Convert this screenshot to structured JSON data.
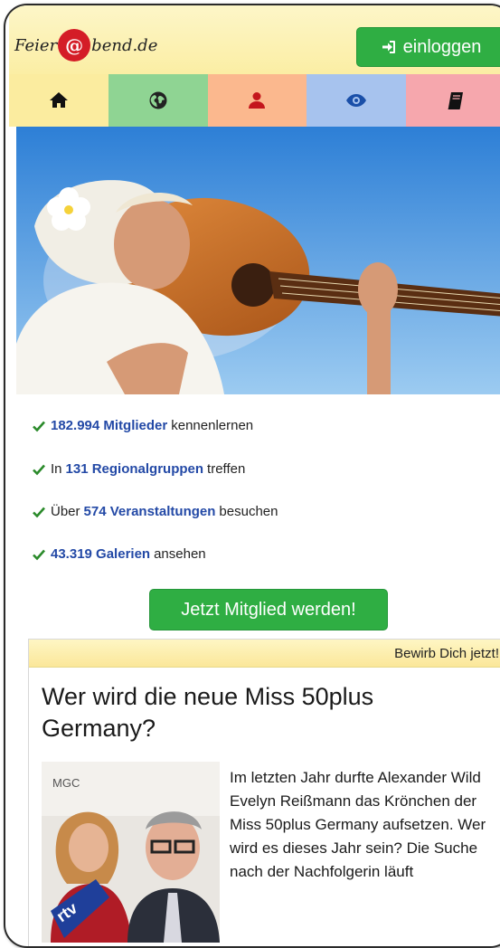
{
  "header": {
    "logo_pre": "Feier",
    "logo_at": "@",
    "logo_post": "bend.de",
    "login_label": "einloggen",
    "login_icon": "sign-in-icon"
  },
  "nav": {
    "items": [
      {
        "icon": "home-icon",
        "color": "#fbec9f"
      },
      {
        "icon": "globe-icon",
        "color": "#8fd493"
      },
      {
        "icon": "user-icon",
        "color": "#fbb88e"
      },
      {
        "icon": "eye-icon",
        "color": "#a7c3ee"
      },
      {
        "icon": "book-icon",
        "color": "#f6a7ad"
      }
    ]
  },
  "stats": [
    {
      "pre": "",
      "value": "182.994 Mitglieder",
      "post": "kennenlernen"
    },
    {
      "pre": "In",
      "value": "131 Regionalgruppen",
      "post": "treffen"
    },
    {
      "pre": "Über",
      "value": "574 Veranstaltungen",
      "post": "besuchen"
    },
    {
      "pre": "",
      "value": "43.319 Galerien",
      "post": "ansehen"
    }
  ],
  "cta_label": "Jetzt Mitglied werden!",
  "article": {
    "bar_label": "Bewirb Dich jetzt!",
    "title": "Wer wird die neue Miss 50plus Germany?",
    "body": "Im letzten Jahr durfte Alexander Wild Evelyn Reißmann das Krönchen der Miss 50plus Germany aufsetzen. Wer wird es dieses Jahr sein? Die Suche nach der Nachfolgerin läuft",
    "photo_text": "rtv"
  },
  "colors": {
    "accent_green": "#2fae43",
    "link_blue": "#2349a6",
    "header_yellow": "#fbeea4"
  }
}
